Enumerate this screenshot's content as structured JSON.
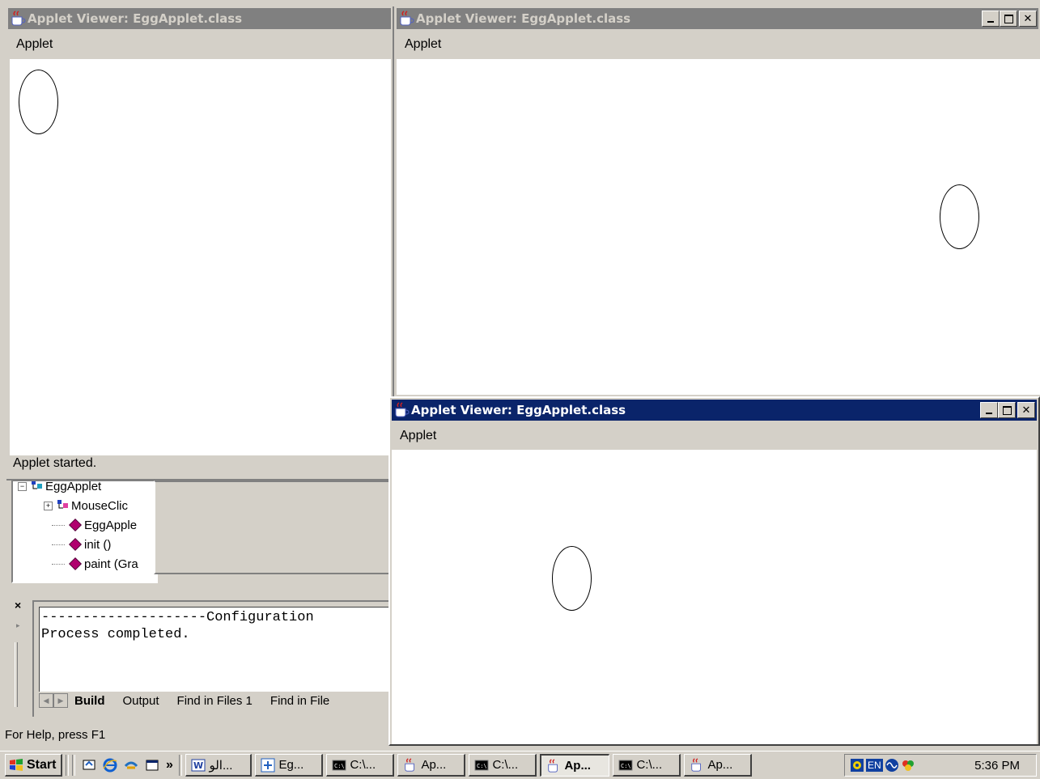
{
  "applet_windows": [
    {
      "title": "Applet Viewer: EggApplet.class",
      "menu": [
        "Applet"
      ],
      "status": "Applet started.",
      "state": "inactive",
      "has_controls": false
    },
    {
      "title": "Applet Viewer: EggApplet.class",
      "menu": [
        "Applet"
      ],
      "status": "",
      "state": "inactive",
      "has_controls": true
    },
    {
      "title": "Applet Viewer: EggApplet.class",
      "menu": [
        "Applet"
      ],
      "status": "",
      "state": "active",
      "has_controls": true
    }
  ],
  "ide": {
    "class_tree": {
      "items": [
        "EggApplet",
        "MouseClic",
        "EggApple",
        "init ()",
        "paint (Gra"
      ]
    },
    "output": {
      "lines": [
        "--------------------Configuration",
        "Process completed."
      ],
      "tabs": [
        "Build",
        "Output",
        "Find in Files 1",
        "Find in File"
      ]
    },
    "close_label": "×",
    "status_bar": "For Help, press F1"
  },
  "taskbar": {
    "start_label": "Start",
    "overflow_label": "»",
    "buttons": [
      {
        "label": "الو...",
        "icon": "word-icon",
        "pressed": false
      },
      {
        "label": "Eg...",
        "icon": "project-icon",
        "pressed": false
      },
      {
        "label": "C:\\...",
        "icon": "console-icon",
        "pressed": false
      },
      {
        "label": "Ap...",
        "icon": "java-icon",
        "pressed": false
      },
      {
        "label": "C:\\...",
        "icon": "console-icon",
        "pressed": false
      },
      {
        "label": "Ap...",
        "icon": "java-icon",
        "pressed": true
      },
      {
        "label": "C:\\...",
        "icon": "console-icon",
        "pressed": false
      },
      {
        "label": "Ap...",
        "icon": "java-icon",
        "pressed": false
      }
    ],
    "tray": {
      "language": "EN",
      "clock": "5:36 PM"
    }
  },
  "colors": {
    "active_title": "#0a246a",
    "inactive_title": "#808080",
    "face": "#d4d0c8"
  }
}
